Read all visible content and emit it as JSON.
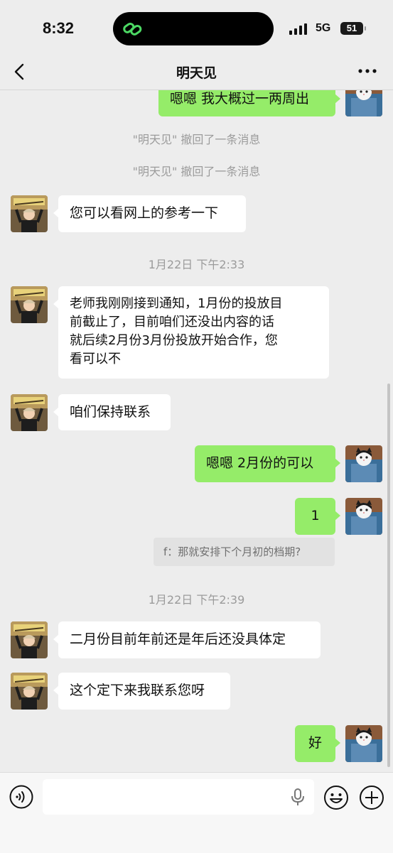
{
  "status_bar": {
    "time": "8:32",
    "network": "5G",
    "battery": "51"
  },
  "header": {
    "title": "明天见"
  },
  "messages": {
    "m1": "嗯嗯 我大概过一两周出",
    "sys1": "\"明天见\" 撤回了一条消息",
    "sys2": "\"明天见\" 撤回了一条消息",
    "m2": "您可以看网上的参考一下",
    "ts1": "1月22日 下午2:33",
    "m3_line1": "老师我刚刚接到通知，1月份的投放目",
    "m3_line2": "前截止了，目前咱们还没出内容的话",
    "m3_line3": "就后续2月份3月份投放开始合作，您",
    "m3_line4": "看可以不",
    "m4": "咱们保持联系",
    "m5": "嗯嗯 2月份的可以",
    "m6": "1",
    "quote": "f：那就安排下个月初的档期?",
    "ts2": "1月22日 下午2:39",
    "m7": "二月份目前年前还是年后还没具体定",
    "m8": "这个定下来我联系您呀",
    "m9": "好"
  },
  "input": {
    "placeholder": ""
  },
  "colors": {
    "outgoing_bubble": "#95ec69",
    "incoming_bubble": "#ffffff",
    "background": "#ededed"
  },
  "icons": [
    "back-icon",
    "more-icon",
    "voice-icon",
    "microphone-icon",
    "emoji-icon",
    "plus-icon"
  ]
}
